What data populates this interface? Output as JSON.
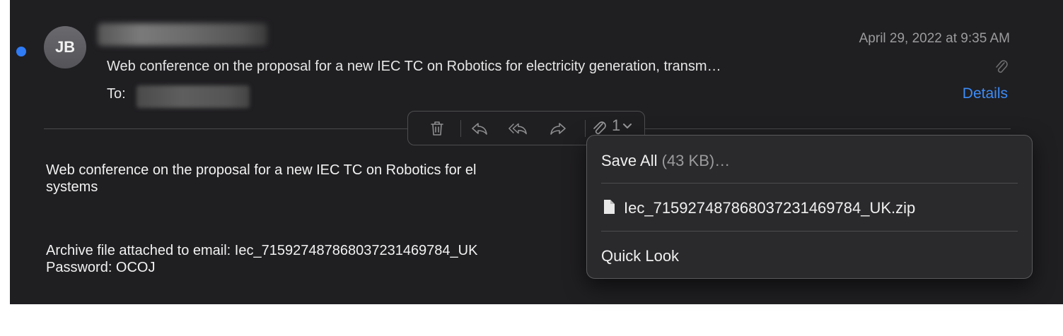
{
  "header": {
    "avatar_initials": "JB",
    "date": "April 29, 2022 at 9:35 AM",
    "subject": "Web conference on the proposal for a new IEC TC on Robotics for electricity generation, transm…",
    "to_label": "To:",
    "details_link": "Details"
  },
  "toolbar": {
    "attachment_count": "1",
    "icons": [
      "trash-icon",
      "reply-icon",
      "reply-all-icon",
      "forward-icon",
      "paperclip-icon",
      "chevron-down-icon"
    ]
  },
  "body": {
    "line1": "Web conference on the proposal for a new IEC TC on Robotics for el",
    "line2": "systems",
    "line3": "Archive file attached to email: Iec_71592748786803723146978​4_UK",
    "line4": "Password: OCOJ"
  },
  "attachment_menu": {
    "save_all_label": "Save All",
    "save_all_size": "(43 KB)…",
    "file_name": "Iec_715927487868037231469784_UK.zip",
    "quick_look": "Quick Look"
  },
  "colors": {
    "background": "#1f1e21",
    "accent_blue": "#3c8cf7",
    "unread_dot": "#2f7cf6"
  }
}
